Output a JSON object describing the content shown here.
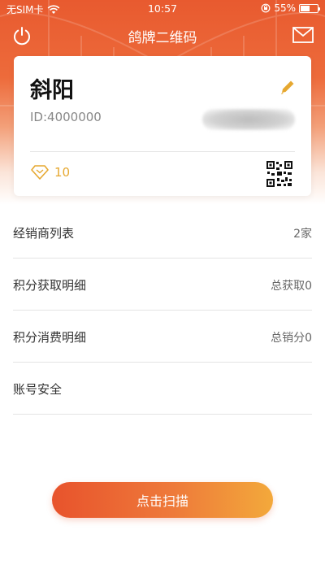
{
  "status_bar": {
    "carrier": "无SIM卡",
    "time": "10:57",
    "battery_percent": "55%",
    "battery_level": 0.55
  },
  "nav": {
    "title": "鸽牌二维码"
  },
  "profile": {
    "name": "斜阳",
    "id_text": "ID:4000000",
    "points": "10"
  },
  "menu": {
    "items": [
      {
        "label": "经销商列表",
        "value": "2家"
      },
      {
        "label": "积分获取明细",
        "value": "总获取0"
      },
      {
        "label": "积分消费明细",
        "value": "总销分0"
      },
      {
        "label": "账号安全",
        "value": ""
      }
    ]
  },
  "actions": {
    "scan_label": "点击扫描"
  },
  "colors": {
    "brand_orange": "#e85a2f",
    "points_gold": "#e6a830",
    "button_gradient_end": "#f3a93b"
  },
  "icons": [
    "wifi-icon",
    "lock-rotation-icon",
    "battery-icon",
    "power-icon",
    "mail-icon",
    "edit-pencil-icon",
    "diamond-icon",
    "qr-code-icon"
  ]
}
